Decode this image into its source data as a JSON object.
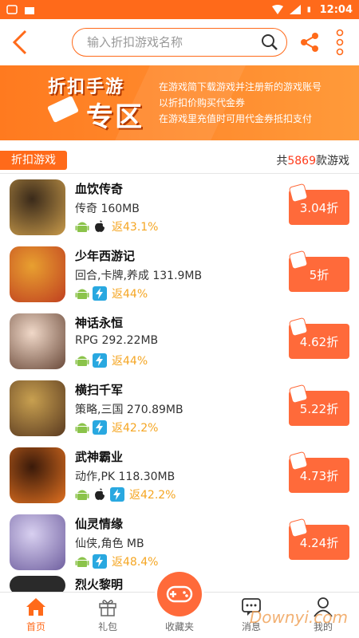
{
  "status_bar": {
    "time": "12:04"
  },
  "search": {
    "placeholder": "输入折扣游戏名称"
  },
  "banner": {
    "title_line1": "折扣手游",
    "title_line2": "专区",
    "lines": [
      "在游戏简下载游戏并注册新的游戏账号",
      "以折扣价购买代金券",
      "在游戏里充值时可用代金券抵扣支付"
    ]
  },
  "section": {
    "label": "折扣游戏",
    "count_prefix": "共",
    "count": "5869",
    "count_suffix": "款游戏"
  },
  "games": [
    {
      "name": "血饮传奇",
      "meta": "传奇 160MB",
      "platforms": [
        "android-icon",
        "apple-icon"
      ],
      "rebate": "返43.1%",
      "discount": "3.04折",
      "icon_colors": [
        "#3a2a1a",
        "#c89a4a"
      ]
    },
    {
      "name": "少年西游记",
      "meta": "回合,卡牌,养成 131.9MB",
      "platforms": [
        "android-icon",
        "lightning-icon"
      ],
      "rebate": "返44%",
      "discount": "5折",
      "icon_colors": [
        "#e8a030",
        "#c04020"
      ]
    },
    {
      "name": "神话永恒",
      "meta": "RPG 292.22MB",
      "platforms": [
        "android-icon",
        "lightning-icon"
      ],
      "rebate": "返44%",
      "discount": "4.62折",
      "icon_colors": [
        "#f0d8c8",
        "#6a4a3a"
      ]
    },
    {
      "name": "横扫千军",
      "meta": "策略,三国 270.89MB",
      "platforms": [
        "android-icon",
        "lightning-icon"
      ],
      "rebate": "返42.2%",
      "discount": "5.22折",
      "icon_colors": [
        "#c8a050",
        "#5a3a20"
      ]
    },
    {
      "name": "武神霸业",
      "meta": "动作,PK 118.30MB",
      "platforms": [
        "android-icon",
        "apple-icon",
        "lightning-icon"
      ],
      "rebate": "返42.2%",
      "discount": "4.73折",
      "icon_colors": [
        "#3a1a0a",
        "#e07020"
      ]
    },
    {
      "name": "仙灵情缘",
      "meta": "仙侠,角色 MB",
      "platforms": [
        "android-icon",
        "lightning-icon"
      ],
      "rebate": "返48.4%",
      "discount": "4.24折",
      "icon_colors": [
        "#d8d0f0",
        "#7060a0"
      ]
    }
  ],
  "partial_game": {
    "name": "烈火黎明"
  },
  "tabs": [
    {
      "label": "首页",
      "icon": "home-icon"
    },
    {
      "label": "礼包",
      "icon": "gift-icon"
    },
    {
      "label": "收藏夹",
      "icon": "gamepad-icon"
    },
    {
      "label": "消息",
      "icon": "message-icon"
    },
    {
      "label": "我的",
      "icon": "user-icon"
    }
  ],
  "watermark": "Downyi.com",
  "colors": {
    "accent": "#ff6a1a",
    "rebate": "#f5a623",
    "discount_bg": "#ff6a3a",
    "android": "#8bc34a",
    "lightning": "#29a8e0"
  }
}
